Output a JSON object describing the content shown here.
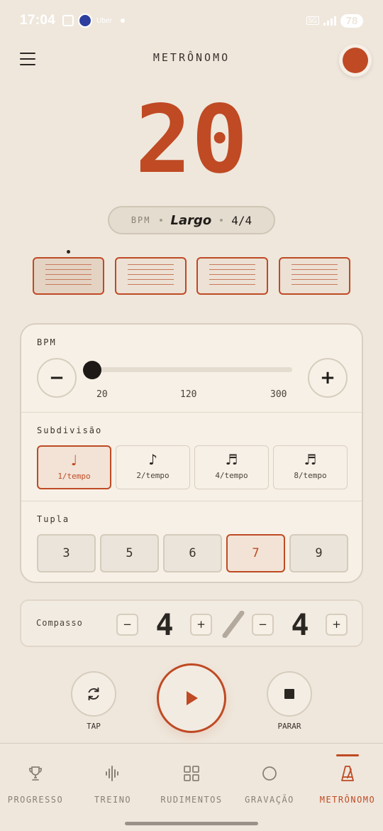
{
  "status_bar": {
    "time": "17:04",
    "app_badge_label": "Uber",
    "network_label": "5G",
    "battery": "78"
  },
  "header": {
    "title": "METRÔNOMO"
  },
  "display": {
    "bpm_value": "20"
  },
  "pill": {
    "bpm_label": "BPM",
    "tempo_name": "Largo",
    "time_signature": "4/4"
  },
  "beats": {
    "count": 4,
    "current_beat": 1
  },
  "bpm_section": {
    "label": "BPM",
    "decrease_label": "−",
    "increase_label": "+",
    "slider": {
      "min": 20,
      "max": 300,
      "value": 20
    },
    "ticks": [
      "20",
      "120",
      "300"
    ]
  },
  "subdivision": {
    "label": "Subdivisão",
    "options": [
      {
        "note": "♩",
        "label": "1/tempo",
        "selected": true
      },
      {
        "note": "♪",
        "label": "2/tempo",
        "selected": false
      },
      {
        "note": "♬",
        "label": "4/tempo",
        "selected": false
      },
      {
        "note": "♬",
        "label": "8/tempo",
        "selected": false
      }
    ]
  },
  "tuplet": {
    "label": "Tupla",
    "options": [
      {
        "value": "3",
        "selected": false
      },
      {
        "value": "5",
        "selected": false
      },
      {
        "value": "6",
        "selected": false
      },
      {
        "value": "7",
        "selected": true
      },
      {
        "value": "9",
        "selected": false
      }
    ]
  },
  "compasso": {
    "label": "Compasso",
    "minus": "−",
    "plus": "+",
    "beats": "4",
    "unit": "4"
  },
  "transport": {
    "tap_label": "TAP",
    "stop_label": "PARAR"
  },
  "nav": {
    "items": [
      {
        "label": "PROGRESSO",
        "icon": "trophy-icon",
        "active": false
      },
      {
        "label": "TREINO",
        "icon": "waveform-icon",
        "active": false
      },
      {
        "label": "RUDIMENTOS",
        "icon": "grid-icon",
        "active": false
      },
      {
        "label": "GRAVAÇÃO",
        "icon": "circle-icon",
        "active": false
      },
      {
        "label": "METRÔNOMO",
        "icon": "metronome-icon",
        "active": true
      }
    ]
  },
  "colors": {
    "accent": "#bf4a24",
    "background": "#efe7dc",
    "card": "#f7f0e6",
    "text": "#2a2622",
    "muted": "#8a8176"
  }
}
